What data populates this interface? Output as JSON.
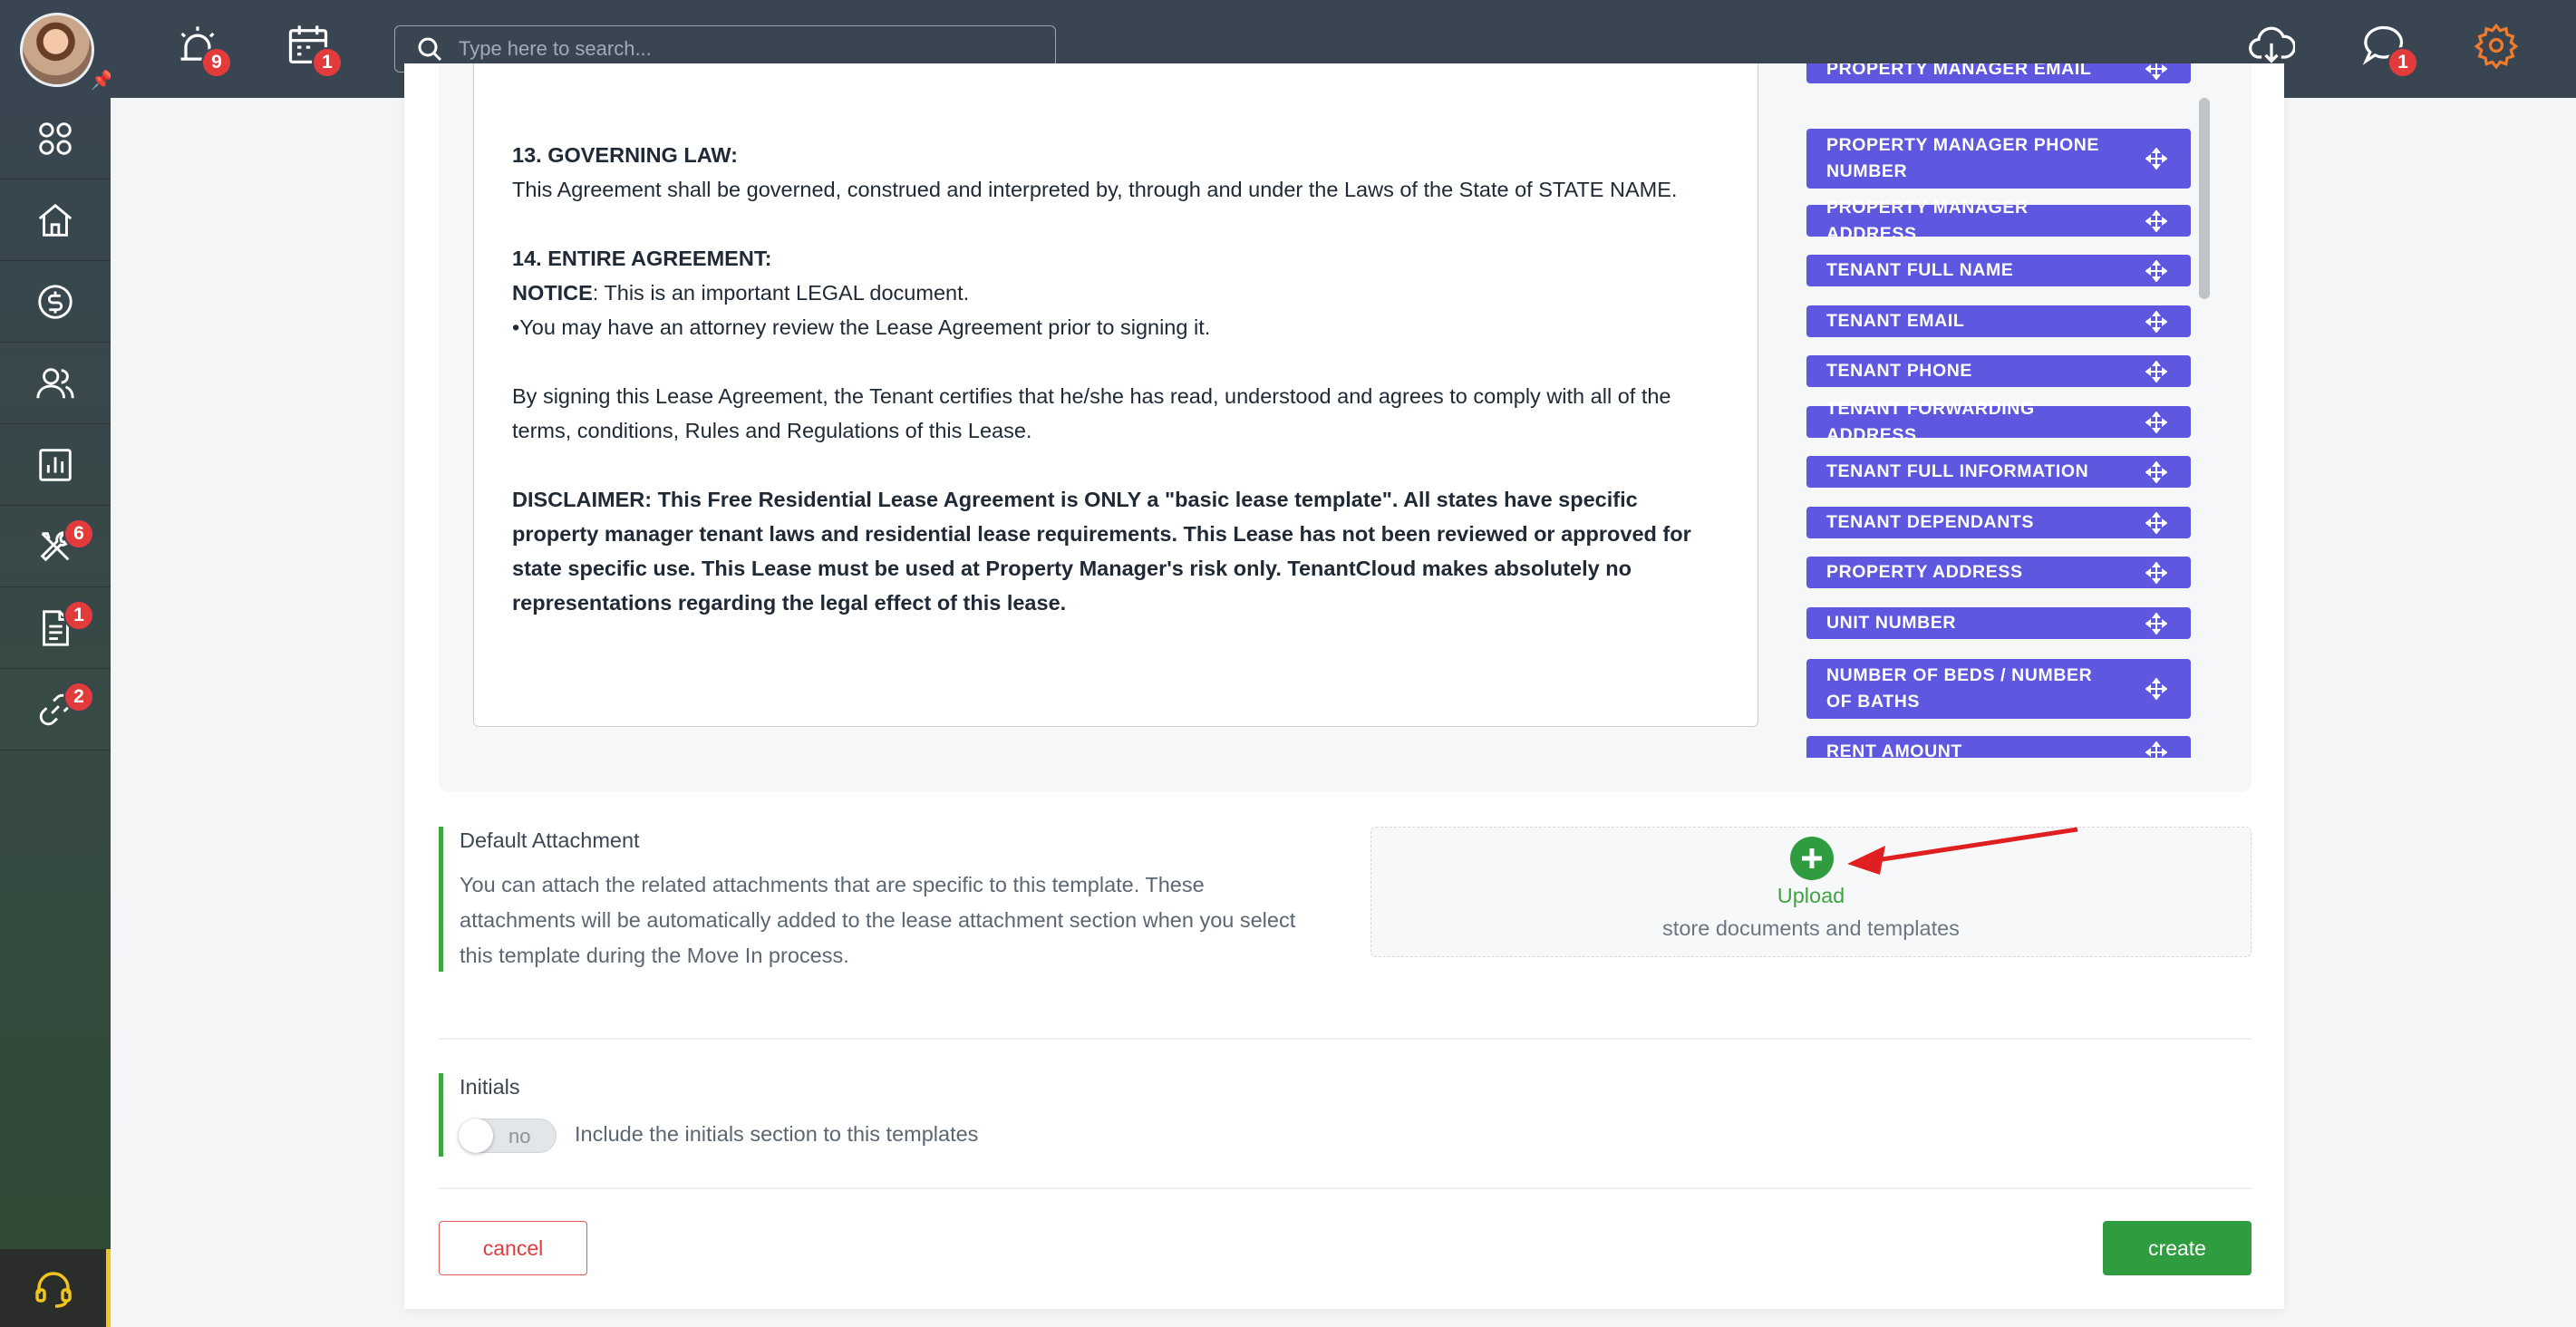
{
  "topbar": {
    "search_placeholder": "Type here to search...",
    "alarm_badge": "9",
    "calendar_badge": "1",
    "chat_badge": "1"
  },
  "sidebar": {
    "tools_badge": "6",
    "documents_badge": "1",
    "links_badge": "2"
  },
  "document": {
    "governing_law_heading": "13. GOVERNING LAW:",
    "governing_law_text": "This Agreement shall be governed, construed and interpreted by, through and under the Laws of the State of STATE NAME.",
    "entire_agreement_heading": "14. ENTIRE AGREEMENT:",
    "notice_label": "NOTICE",
    "notice_text": ": This is an important LEGAL document.",
    "attorney_text": "•You may have an attorney review the Lease Agreement prior to signing it.",
    "signing_text": "By signing this Lease Agreement, the Tenant certifies that he/she has read, understood and agrees to comply with all of the terms, conditions, Rules and Regulations of this Lease.",
    "disclaimer_text": "DISCLAIMER: This Free Residential Lease Agreement is ONLY a \"basic lease template\". All states have specific property manager tenant laws and residential lease requirements. This Lease has not been reviewed or approved for state specific use. This Lease must be used at Property Manager's risk only. TenantCloud makes absolutely no representations regarding the legal effect of this lease."
  },
  "tags": [
    "PROPERTY MANAGER EMAIL",
    "PROPERTY MANAGER PHONE NUMBER",
    "PROPERTY MANAGER ADDRESS",
    "TENANT FULL NAME",
    "TENANT EMAIL",
    "TENANT PHONE",
    "TENANT FORWARDING ADDRESS",
    "TENANT FULL INFORMATION",
    "TENANT DEPENDANTS",
    "PROPERTY ADDRESS",
    "UNIT NUMBER",
    "NUMBER OF BEDS / NUMBER OF BATHS",
    "RENT AMOUNT"
  ],
  "attachment": {
    "title": "Default Attachment",
    "description": "You can attach the related attachments that are specific to this template. These attachments will be automatically added to the lease attachment section when you select this template during the Move In process.",
    "upload_label": "Upload",
    "upload_sub": "store documents and templates"
  },
  "initials": {
    "title": "Initials",
    "toggle_value": "no",
    "toggle_label": "Include the initials section to this templates"
  },
  "actions": {
    "cancel": "cancel",
    "create": "create"
  },
  "colors": {
    "topbar": "#3a4552",
    "tag": "#5e57df",
    "accent_green": "#2f9c3f",
    "badge_red": "#e23b3b",
    "cancel_red": "#e03c3c",
    "settings_orange": "#f07b2a",
    "support_yellow": "#f2c51c"
  }
}
